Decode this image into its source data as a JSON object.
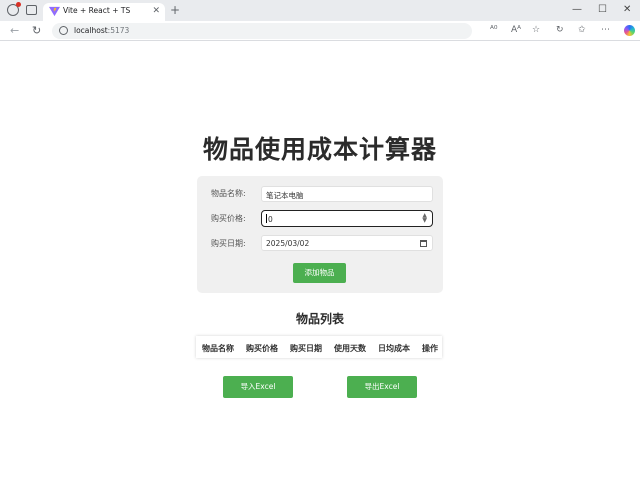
{
  "browser": {
    "tab_title": "Vite + React + TS",
    "tab_close": "✕",
    "new_tab": "+",
    "url_host": "localhost",
    "url_port": ":5173",
    "window_controls": {
      "minimize": "—",
      "maximize": "☐",
      "close": "✕"
    },
    "nav": {
      "back": "←",
      "refresh": "↻"
    },
    "toolbar_icons": [
      "read-aloud-icon",
      "text-size-icon",
      "favorite-star-icon",
      "refresh-extensions-icon",
      "favorites-icon",
      "more-icon",
      "copilot-icon"
    ]
  },
  "app": {
    "title": "物品使用成本计算器",
    "form": {
      "name_label": "物品名称:",
      "name_value": "笔记本电脑",
      "price_label": "购买价格:",
      "price_value": "0",
      "date_label": "购买日期:",
      "date_value": "2025/03/02",
      "add_button": "添加物品"
    },
    "list_title": "物品列表",
    "table_headers": [
      "物品名称",
      "购买价格",
      "购买日期",
      "使用天数",
      "日均成本",
      "操作"
    ],
    "import_button": "导入Excel",
    "export_button": "导出Excel"
  },
  "colors": {
    "accent": "#4caf50",
    "card_bg": "#f0f0f0"
  }
}
